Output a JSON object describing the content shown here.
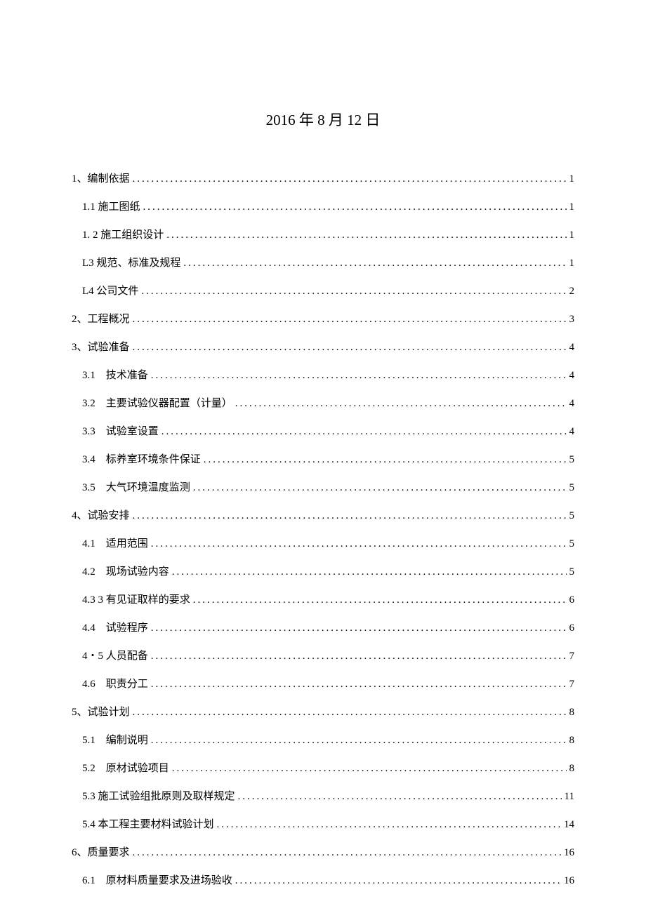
{
  "title": "2016 年 8 月 12 日",
  "toc": [
    {
      "level": 1,
      "label": "1、编制依据",
      "page": "1"
    },
    {
      "level": 2,
      "label": "1.1 施工图纸",
      "page": "1"
    },
    {
      "level": 2,
      "label": "1. 2 施工组织设计",
      "page": "1"
    },
    {
      "level": 2,
      "label": "L3 规范、标准及规程",
      "page": "1"
    },
    {
      "level": 2,
      "label": "L4 公司文件",
      "page": "2"
    },
    {
      "level": 1,
      "label": "2、工程概况",
      "page": "3"
    },
    {
      "level": 1,
      "label": "3、试验准备",
      "page": "4"
    },
    {
      "level": 2,
      "label": "3.1　技术准备",
      "page": "4"
    },
    {
      "level": 2,
      "label": "3.2　主要试验仪器配置（计量）",
      "page": "4"
    },
    {
      "level": 2,
      "label": "3.3　试验室设置",
      "page": "4"
    },
    {
      "level": 2,
      "label": "3.4　标养室环境条件保证",
      "page": "5"
    },
    {
      "level": 2,
      "label": "3.5　大气环境温度监测",
      "page": "5"
    },
    {
      "level": 1,
      "label": "4、试验安排",
      "page": "5"
    },
    {
      "level": 2,
      "label": "4.1　适用范围",
      "page": "5"
    },
    {
      "level": 2,
      "label": "4.2　现场试验内容",
      "page": "5"
    },
    {
      "level": 2,
      "label": "4.3 3 有见证取样的要求",
      "page": "6"
    },
    {
      "level": 2,
      "label": "4.4　试验程序",
      "page": "6"
    },
    {
      "level": 2,
      "label": "4・5 人员配备",
      "page": "7"
    },
    {
      "level": 2,
      "label": "4.6　职责分工",
      "page": "7"
    },
    {
      "level": 1,
      "label": "5、试验计划",
      "page": "8"
    },
    {
      "level": 2,
      "label": "5.1　编制说明",
      "page": "8"
    },
    {
      "level": 2,
      "label": "5.2　原材试验项目",
      "page": "8"
    },
    {
      "level": 2,
      "label": "5.3 施工试验组批原则及取样规定",
      "page": "11"
    },
    {
      "level": 2,
      "label": "5.4 本工程主要材料试验计划",
      "page": "14"
    },
    {
      "level": 1,
      "label": "6、质量要求",
      "page": "16"
    },
    {
      "level": 2,
      "label": "6.1　原材料质量要求及进场验收",
      "page": "16"
    }
  ]
}
